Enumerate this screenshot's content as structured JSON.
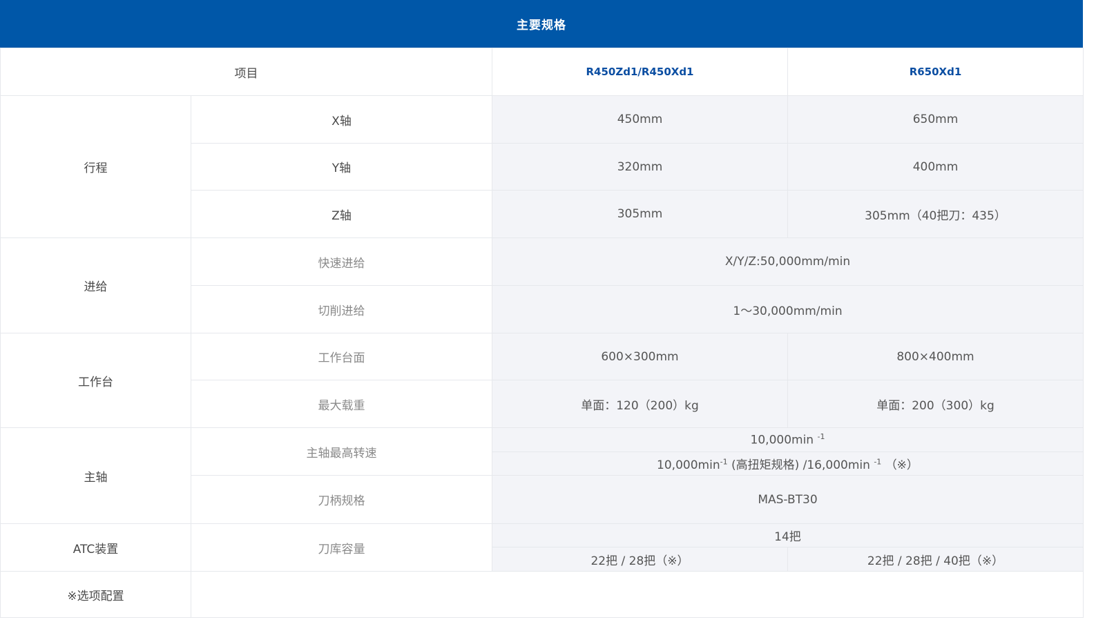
{
  "header": {
    "title": "主要规格"
  },
  "columns": {
    "item": "项目",
    "model1": "R450Zd1/R450Xd1",
    "model2": "R650Xd1"
  },
  "travel": {
    "category": "行程",
    "x": {
      "label": "X轴",
      "v1": "450mm",
      "v2": "650mm"
    },
    "y": {
      "label": "Y轴",
      "v1": "320mm",
      "v2": "400mm"
    },
    "z": {
      "label": "Z轴",
      "v1": "305mm",
      "v2": "305mm（40把刀：435）"
    }
  },
  "feed": {
    "category": "进给",
    "rapid": {
      "label": "快速进给",
      "value": "X/Y/Z:50,000mm/min"
    },
    "cutting": {
      "label": "切削进给",
      "value": "1～30,000mm/min"
    }
  },
  "table": {
    "category": "工作台",
    "surface": {
      "label": "工作台面",
      "v1": "600×300mm",
      "v2": "800×400mm"
    },
    "load": {
      "label": "最大载重",
      "v1": "单面：120（200）kg",
      "v2": "单面：200（300）kg"
    }
  },
  "spindle": {
    "category": "主轴",
    "speed": {
      "label": "主轴最高转速",
      "line1_a": "10,000min",
      "line1_sup": "-1",
      "line2_a": "10,000min",
      "line2_sup1": "-1",
      "line2_b": " (高扭矩规格) /16,000min",
      "line2_sup2": "-1",
      "line2_c": "（※）"
    },
    "holder": {
      "label": "刀柄规格",
      "value": "MAS-BT30"
    }
  },
  "atc": {
    "category": "ATC装置",
    "capacity": {
      "label": "刀库容量",
      "standard": "14把",
      "v1": "22把 / 28把（※）",
      "v2": "22把 / 28把 / 40把（※）"
    }
  },
  "note": "※选项配置"
}
